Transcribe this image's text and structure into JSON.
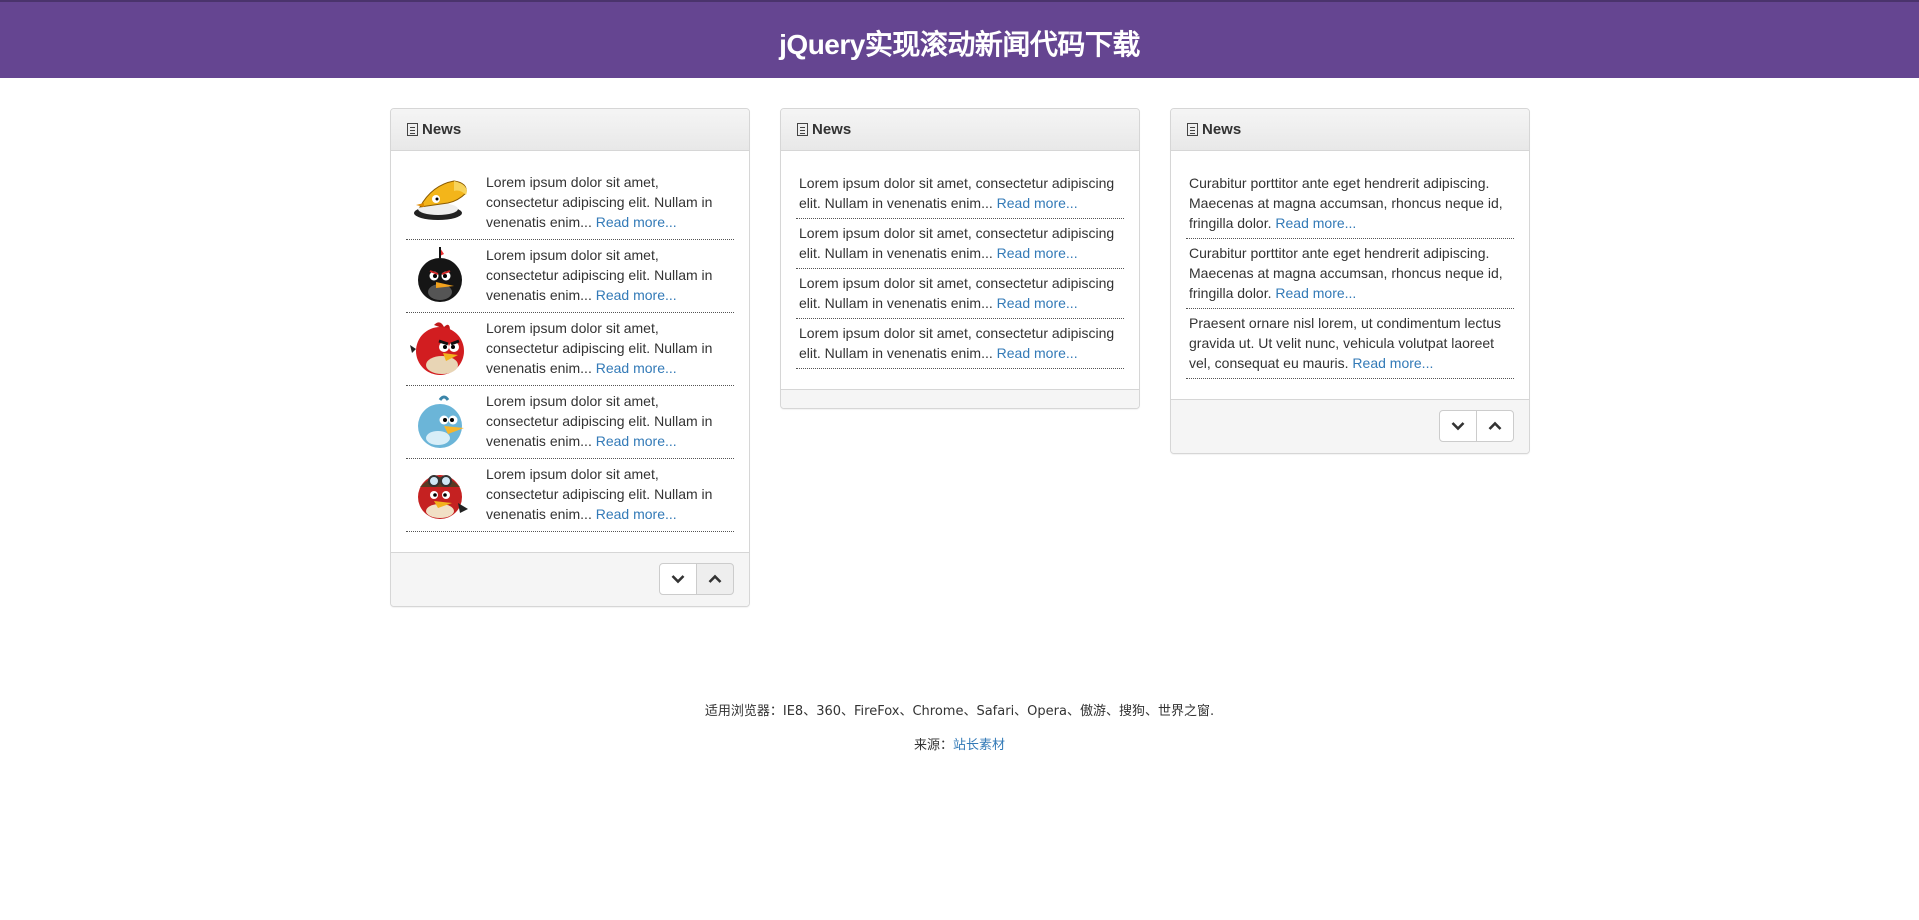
{
  "header": {
    "title": "jQuery实现滚动新闻代码下载"
  },
  "panels": [
    {
      "title": "News",
      "items": [
        {
          "text": "Lorem ipsum dolor sit amet, consectetur adipiscing elit. Nullam in venenatis enim...",
          "link": "Read more...",
          "icon": "yellow-bird-icon"
        },
        {
          "text": "Lorem ipsum dolor sit amet, consectetur adipiscing elit. Nullam in venenatis enim...",
          "link": "Read more...",
          "icon": "black-bird-icon"
        },
        {
          "text": "Lorem ipsum dolor sit amet, consectetur adipiscing elit. Nullam in venenatis enim...",
          "link": "Read more...",
          "icon": "red-bird-icon"
        },
        {
          "text": "Lorem ipsum dolor sit amet, consectetur adipiscing elit. Nullam in venenatis enim...",
          "link": "Read more...",
          "icon": "blue-bird-icon"
        },
        {
          "text": "Lorem ipsum dolor sit amet, consectetur adipiscing elit. Nullam in venenatis enim...",
          "link": "Read more...",
          "icon": "aviator-bird-icon"
        }
      ]
    },
    {
      "title": "News",
      "items": [
        {
          "text": "Lorem ipsum dolor sit amet, consectetur adipiscing elit. Nullam in venenatis enim...",
          "link": "Read more..."
        },
        {
          "text": "Lorem ipsum dolor sit amet, consectetur adipiscing elit. Nullam in venenatis enim...",
          "link": "Read more..."
        },
        {
          "text": "Lorem ipsum dolor sit amet, consectetur adipiscing elit. Nullam in venenatis enim...",
          "link": "Read more..."
        },
        {
          "text": "Lorem ipsum dolor sit amet, consectetur adipiscing elit. Nullam in venenatis enim...",
          "link": "Read more..."
        }
      ]
    },
    {
      "title": "News",
      "items": [
        {
          "text": "Curabitur porttitor ante eget hendrerit adipiscing. Maecenas at magna accumsan, rhoncus neque id, fringilla dolor.",
          "link": "Read more..."
        },
        {
          "text": "Curabitur porttitor ante eget hendrerit adipiscing. Maecenas at magna accumsan, rhoncus neque id, fringilla dolor.",
          "link": "Read more..."
        },
        {
          "text": "Praesent ornare nisl lorem, ut condimentum lectus gravida ut. Ut velit nunc, vehicula volutpat laoreet vel, consequat eu mauris.",
          "link": "Read more..."
        }
      ]
    }
  ],
  "footer": {
    "browsers": "适用浏览器：IE8、360、FireFox、Chrome、Safari、Opera、傲游、搜狗、世界之窗.",
    "source_label": "来源：",
    "source_link": "站长素材"
  },
  "colors": {
    "header_bg": "#654591",
    "link": "#337ab7"
  }
}
